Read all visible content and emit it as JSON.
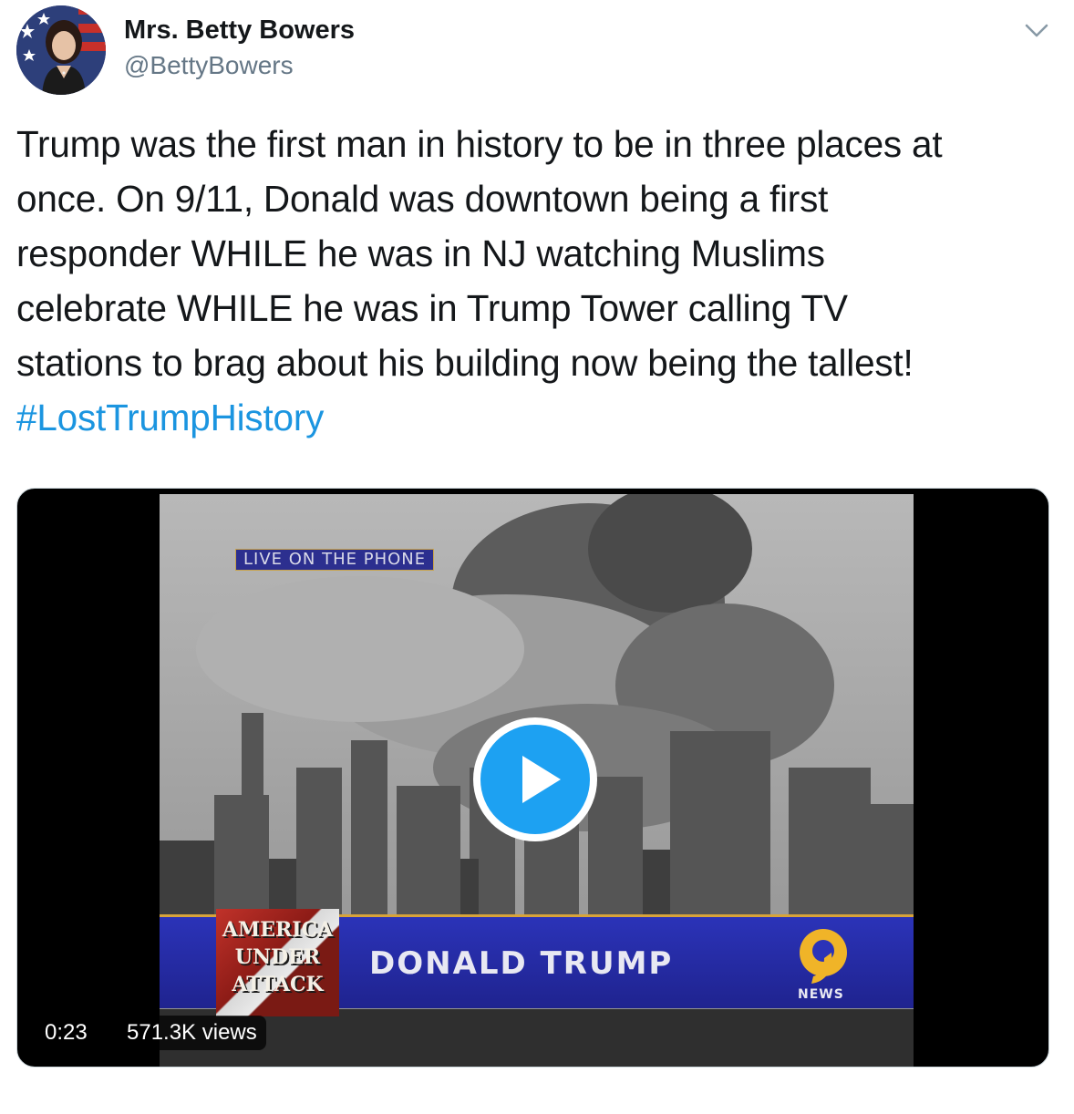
{
  "author": {
    "display_name": "Mrs. Betty Bowers",
    "handle": "@BettyBowers",
    "avatar_icon": "avatar-portrait-with-flag"
  },
  "menu": {
    "icon": "chevron-down-icon"
  },
  "tweet": {
    "lines": [
      "Trump was the first man in history to be in three places at",
      "once. On 9/11, Donald was downtown being a first",
      "responder WHILE he was in NJ watching Muslims",
      "celebrate WHILE he was in Trump Tower calling TV",
      "stations to brag about his building now being the tallest!"
    ],
    "hashtag": "#LostTrumpHistory",
    "hashtag_color": "#1b95e0"
  },
  "video": {
    "overlay_label": "LIVE ON THE PHONE",
    "badge_text": [
      "AMERICA",
      "UNDER",
      "ATTACK"
    ],
    "lower_third_name": "DONALD TRUMP",
    "channel_logo_text": "NEWS",
    "duration": "0:23",
    "views": "571.3K views",
    "play_icon": "play-icon",
    "accent_color": "#1da1f2"
  }
}
